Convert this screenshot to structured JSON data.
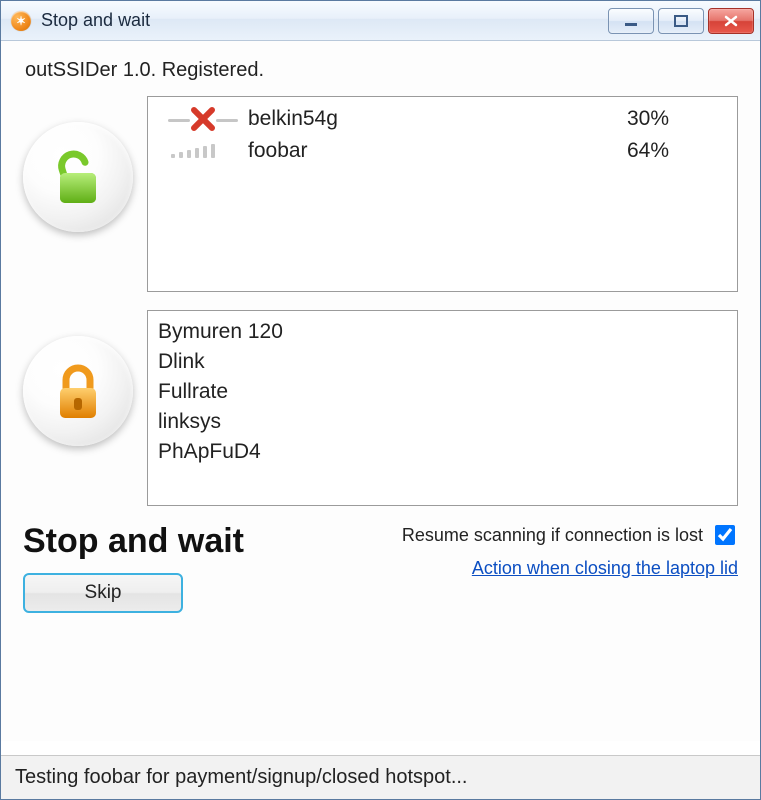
{
  "window": {
    "title": "Stop and wait"
  },
  "header": {
    "registered_text": "outSSIDer 1.0. Registered."
  },
  "open_networks": {
    "items": [
      {
        "name": "belkin54g",
        "percent": "30%",
        "status": "failed"
      },
      {
        "name": "foobar",
        "percent": "64%",
        "status": "ok"
      }
    ]
  },
  "locked_networks": {
    "items": [
      {
        "name": "Bymuren 120"
      },
      {
        "name": "Dlink"
      },
      {
        "name": "Fullrate"
      },
      {
        "name": "linksys"
      },
      {
        "name": "PhApFuD4"
      }
    ]
  },
  "footer": {
    "big_label": "Stop and wait",
    "skip_label": "Skip",
    "resume_label": "Resume scanning if connection is lost",
    "resume_checked": true,
    "lid_link": "Action when closing the laptop lid"
  },
  "status": {
    "text": "Testing foobar for payment/signup/closed hotspot..."
  },
  "colors": {
    "open_lock": "#7ac92b",
    "locked_lock": "#f09a1d",
    "fail_x": "#d63a2a"
  }
}
